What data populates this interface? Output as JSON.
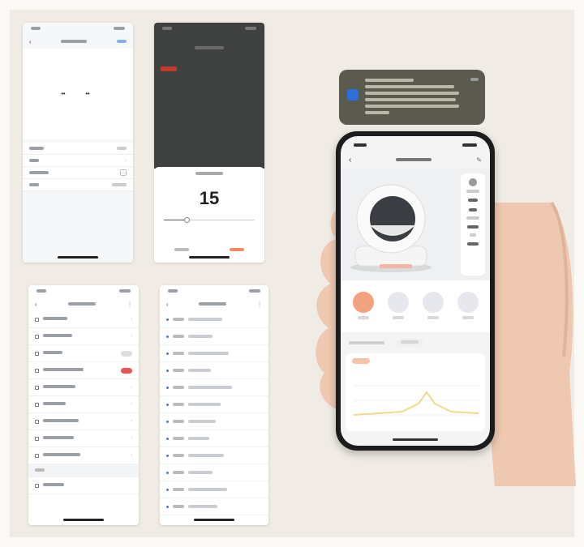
{
  "screen2": {
    "countdown_value": "15",
    "slider_level": 0.25
  },
  "phone": {
    "chart_line_color": "#f2d98a",
    "active_mode_color": "#f2a27f",
    "modes": [
      "",
      "",
      "",
      ""
    ]
  },
  "screen3_rows": [
    {
      "type": "none"
    },
    {
      "type": "none"
    },
    {
      "type": "gray"
    },
    {
      "type": "red"
    },
    {
      "type": "none"
    },
    {
      "type": "none"
    },
    {
      "type": "none"
    },
    {
      "type": "none"
    },
    {
      "type": "none"
    }
  ],
  "screen4_rows": 12
}
